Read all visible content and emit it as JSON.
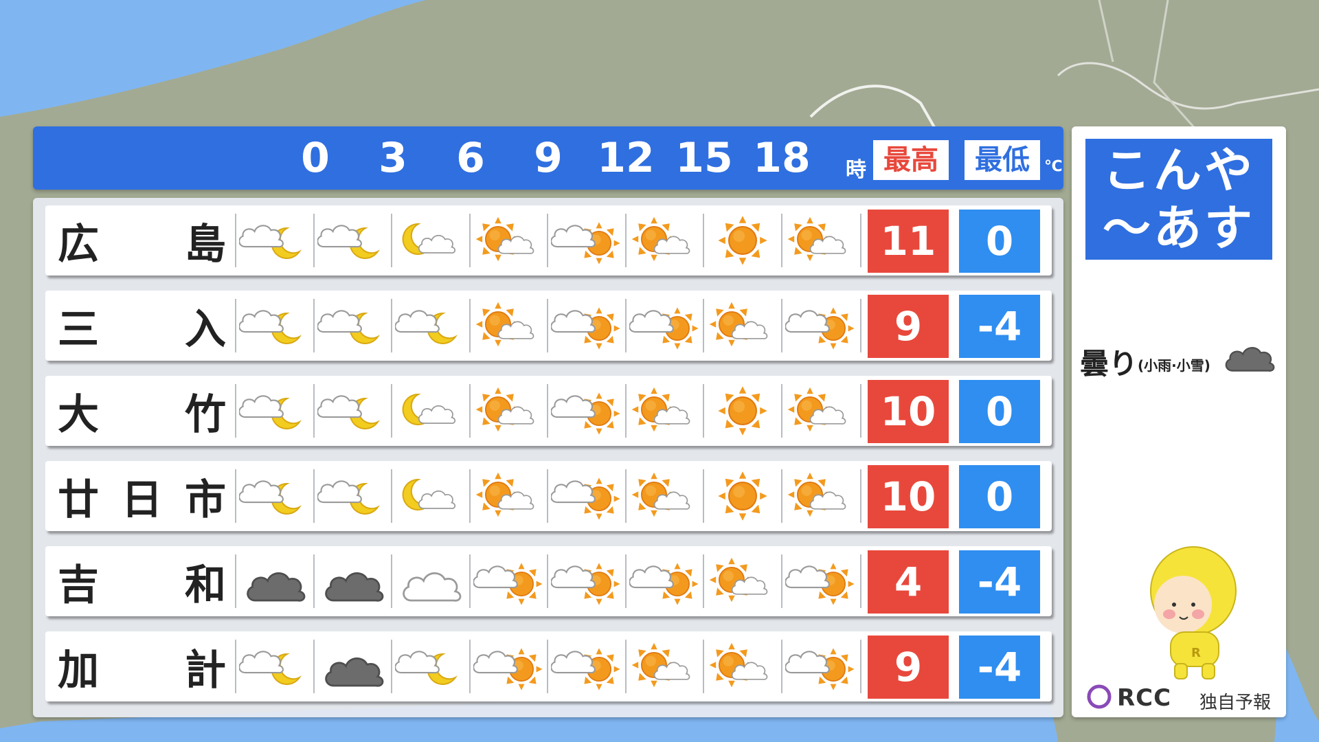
{
  "hours": [
    "0",
    "3",
    "6",
    "9",
    "12",
    "15",
    "18"
  ],
  "hour_unit": "時",
  "header": {
    "max_label": "最高",
    "min_label": "最低",
    "temp_unit": "℃"
  },
  "side": {
    "title_line1": "こんや",
    "title_line2": "〜あす",
    "legend_label": "曇り",
    "legend_sub": "(小雨·小雪)",
    "brand_name": "RCC",
    "brand_tag": "独自予報"
  },
  "colors": {
    "header_blue": "#2f6fe0",
    "max_red": "#e8483c",
    "min_blue": "#2f8ef0",
    "sun_orange": "#f39a1e",
    "moon_yellow": "#f2cc1f",
    "dark_cloud": "#6c6c6c"
  },
  "rows": [
    {
      "name": "広島",
      "chars": [
        "広",
        "",
        "島"
      ],
      "icons": [
        "cloud-moon-icon",
        "cloud-moon-icon",
        "moon-cloud-icon",
        "sun-cloud-icon",
        "cloud-sun-icon",
        "sun-cloud-icon",
        "sun-icon",
        "sun-cloud-icon"
      ],
      "max": "11",
      "min": "0"
    },
    {
      "name": "三入",
      "chars": [
        "三",
        "",
        "入"
      ],
      "icons": [
        "cloud-moon-icon",
        "cloud-moon-icon",
        "cloud-moon-icon",
        "sun-cloud-icon",
        "cloud-sun-icon",
        "cloud-sun-icon",
        "sun-cloud-icon",
        "cloud-sun-icon"
      ],
      "max": "9",
      "min": "-4"
    },
    {
      "name": "大竹",
      "chars": [
        "大",
        "",
        "竹"
      ],
      "icons": [
        "cloud-moon-icon",
        "cloud-moon-icon",
        "moon-cloud-icon",
        "sun-cloud-icon",
        "cloud-sun-icon",
        "sun-cloud-icon",
        "sun-icon",
        "sun-cloud-icon"
      ],
      "max": "10",
      "min": "0"
    },
    {
      "name": "廿日市",
      "chars": [
        "廿",
        "日",
        "市"
      ],
      "icons": [
        "cloud-moon-icon",
        "cloud-moon-icon",
        "moon-cloud-icon",
        "sun-cloud-icon",
        "cloud-sun-icon",
        "sun-cloud-icon",
        "sun-icon",
        "sun-cloud-icon"
      ],
      "max": "10",
      "min": "0"
    },
    {
      "name": "吉和",
      "chars": [
        "吉",
        "",
        "和"
      ],
      "icons": [
        "dark-cloud-icon",
        "dark-cloud-icon",
        "cloud-icon",
        "cloud-sun-icon",
        "cloud-sun-icon",
        "cloud-sun-icon",
        "sun-cloud-icon",
        "cloud-sun-icon"
      ],
      "max": "4",
      "min": "-4"
    },
    {
      "name": "加計",
      "chars": [
        "加",
        "",
        "計"
      ],
      "icons": [
        "cloud-moon-icon",
        "dark-cloud-icon",
        "cloud-moon-icon",
        "cloud-sun-icon",
        "cloud-sun-icon",
        "sun-cloud-icon",
        "sun-cloud-icon",
        "cloud-sun-icon"
      ],
      "max": "9",
      "min": "-4"
    }
  ]
}
